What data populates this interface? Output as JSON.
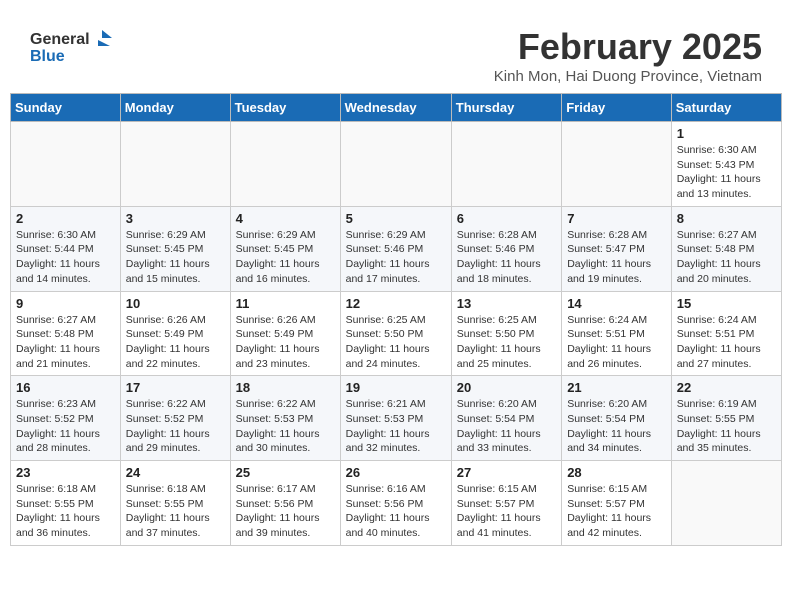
{
  "header": {
    "logo_general": "General",
    "logo_blue": "Blue",
    "month_title": "February 2025",
    "location": "Kinh Mon, Hai Duong Province, Vietnam"
  },
  "weekdays": [
    "Sunday",
    "Monday",
    "Tuesday",
    "Wednesday",
    "Thursday",
    "Friday",
    "Saturday"
  ],
  "weeks": [
    [
      {
        "day": "",
        "info": ""
      },
      {
        "day": "",
        "info": ""
      },
      {
        "day": "",
        "info": ""
      },
      {
        "day": "",
        "info": ""
      },
      {
        "day": "",
        "info": ""
      },
      {
        "day": "",
        "info": ""
      },
      {
        "day": "1",
        "info": "Sunrise: 6:30 AM\nSunset: 5:43 PM\nDaylight: 11 hours and 13 minutes."
      }
    ],
    [
      {
        "day": "2",
        "info": "Sunrise: 6:30 AM\nSunset: 5:44 PM\nDaylight: 11 hours and 14 minutes."
      },
      {
        "day": "3",
        "info": "Sunrise: 6:29 AM\nSunset: 5:45 PM\nDaylight: 11 hours and 15 minutes."
      },
      {
        "day": "4",
        "info": "Sunrise: 6:29 AM\nSunset: 5:45 PM\nDaylight: 11 hours and 16 minutes."
      },
      {
        "day": "5",
        "info": "Sunrise: 6:29 AM\nSunset: 5:46 PM\nDaylight: 11 hours and 17 minutes."
      },
      {
        "day": "6",
        "info": "Sunrise: 6:28 AM\nSunset: 5:46 PM\nDaylight: 11 hours and 18 minutes."
      },
      {
        "day": "7",
        "info": "Sunrise: 6:28 AM\nSunset: 5:47 PM\nDaylight: 11 hours and 19 minutes."
      },
      {
        "day": "8",
        "info": "Sunrise: 6:27 AM\nSunset: 5:48 PM\nDaylight: 11 hours and 20 minutes."
      }
    ],
    [
      {
        "day": "9",
        "info": "Sunrise: 6:27 AM\nSunset: 5:48 PM\nDaylight: 11 hours and 21 minutes."
      },
      {
        "day": "10",
        "info": "Sunrise: 6:26 AM\nSunset: 5:49 PM\nDaylight: 11 hours and 22 minutes."
      },
      {
        "day": "11",
        "info": "Sunrise: 6:26 AM\nSunset: 5:49 PM\nDaylight: 11 hours and 23 minutes."
      },
      {
        "day": "12",
        "info": "Sunrise: 6:25 AM\nSunset: 5:50 PM\nDaylight: 11 hours and 24 minutes."
      },
      {
        "day": "13",
        "info": "Sunrise: 6:25 AM\nSunset: 5:50 PM\nDaylight: 11 hours and 25 minutes."
      },
      {
        "day": "14",
        "info": "Sunrise: 6:24 AM\nSunset: 5:51 PM\nDaylight: 11 hours and 26 minutes."
      },
      {
        "day": "15",
        "info": "Sunrise: 6:24 AM\nSunset: 5:51 PM\nDaylight: 11 hours and 27 minutes."
      }
    ],
    [
      {
        "day": "16",
        "info": "Sunrise: 6:23 AM\nSunset: 5:52 PM\nDaylight: 11 hours and 28 minutes."
      },
      {
        "day": "17",
        "info": "Sunrise: 6:22 AM\nSunset: 5:52 PM\nDaylight: 11 hours and 29 minutes."
      },
      {
        "day": "18",
        "info": "Sunrise: 6:22 AM\nSunset: 5:53 PM\nDaylight: 11 hours and 30 minutes."
      },
      {
        "day": "19",
        "info": "Sunrise: 6:21 AM\nSunset: 5:53 PM\nDaylight: 11 hours and 32 minutes."
      },
      {
        "day": "20",
        "info": "Sunrise: 6:20 AM\nSunset: 5:54 PM\nDaylight: 11 hours and 33 minutes."
      },
      {
        "day": "21",
        "info": "Sunrise: 6:20 AM\nSunset: 5:54 PM\nDaylight: 11 hours and 34 minutes."
      },
      {
        "day": "22",
        "info": "Sunrise: 6:19 AM\nSunset: 5:55 PM\nDaylight: 11 hours and 35 minutes."
      }
    ],
    [
      {
        "day": "23",
        "info": "Sunrise: 6:18 AM\nSunset: 5:55 PM\nDaylight: 11 hours and 36 minutes."
      },
      {
        "day": "24",
        "info": "Sunrise: 6:18 AM\nSunset: 5:55 PM\nDaylight: 11 hours and 37 minutes."
      },
      {
        "day": "25",
        "info": "Sunrise: 6:17 AM\nSunset: 5:56 PM\nDaylight: 11 hours and 39 minutes."
      },
      {
        "day": "26",
        "info": "Sunrise: 6:16 AM\nSunset: 5:56 PM\nDaylight: 11 hours and 40 minutes."
      },
      {
        "day": "27",
        "info": "Sunrise: 6:15 AM\nSunset: 5:57 PM\nDaylight: 11 hours and 41 minutes."
      },
      {
        "day": "28",
        "info": "Sunrise: 6:15 AM\nSunset: 5:57 PM\nDaylight: 11 hours and 42 minutes."
      },
      {
        "day": "",
        "info": ""
      }
    ]
  ]
}
